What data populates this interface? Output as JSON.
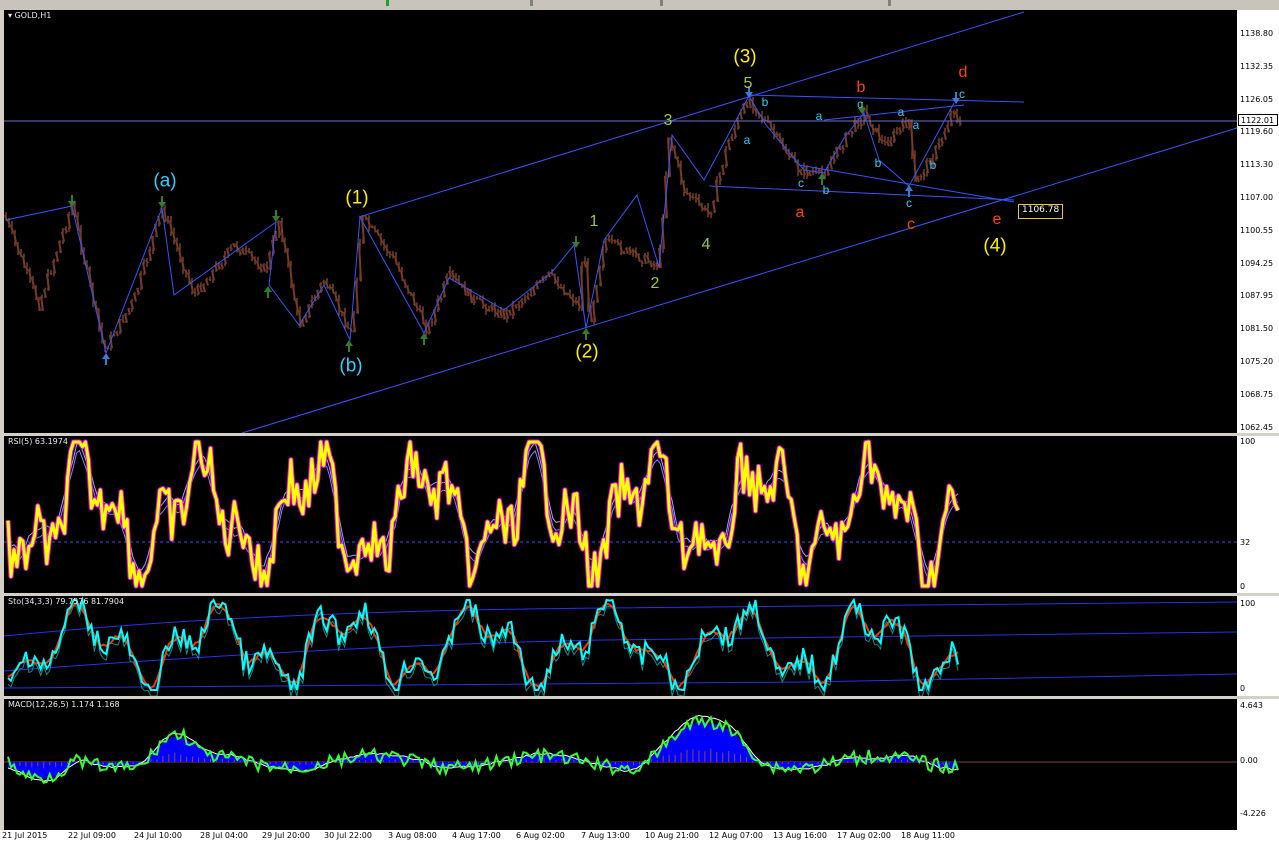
{
  "window": {
    "title": "GOLD,H1"
  },
  "main_chart": {
    "symbol_label": "GOLD,H1",
    "price_axis": [
      "1138.80",
      "1132.35",
      "1126.05",
      "1119.60",
      "1113.30",
      "1107.00",
      "1100.55",
      "1094.25",
      "1087.95",
      "1081.50",
      "1075.20",
      "1068.75",
      "1062.45"
    ],
    "current_price": "1122.01",
    "level_tag": "1106.78",
    "wave_labels": [
      {
        "text": "(a)",
        "color": "#33ccff",
        "size": "big"
      },
      {
        "text": "(b)",
        "color": "#33ccff",
        "size": "big"
      },
      {
        "text": "(1)",
        "color": "#ffee00",
        "size": "big"
      },
      {
        "text": "(2)",
        "color": "#ffee00",
        "size": "big"
      },
      {
        "text": "(3)",
        "color": "#ffee00",
        "size": "big"
      },
      {
        "text": "(4)",
        "color": "#ffee00",
        "size": "big"
      },
      {
        "text": "1",
        "color": "#99cc33",
        "size": "mid"
      },
      {
        "text": "2",
        "color": "#99cc33",
        "size": "mid"
      },
      {
        "text": "3",
        "color": "#99cc33",
        "size": "mid"
      },
      {
        "text": "4",
        "color": "#99cc33",
        "size": "mid"
      },
      {
        "text": "5",
        "color": "#99cc33",
        "size": "mid"
      },
      {
        "text": "a",
        "color": "#ff4400",
        "size": "mid"
      },
      {
        "text": "b",
        "color": "#ff4400",
        "size": "mid"
      },
      {
        "text": "c",
        "color": "#ff4400",
        "size": "mid"
      },
      {
        "text": "d",
        "color": "#ff4400",
        "size": "mid"
      },
      {
        "text": "e",
        "color": "#ff4400",
        "size": "mid"
      },
      {
        "text": "a",
        "color": "#33ccff",
        "size": "small"
      },
      {
        "text": "b",
        "color": "#33ccff",
        "size": "small"
      },
      {
        "text": "c",
        "color": "#33ccff",
        "size": "small"
      },
      {
        "text": "b",
        "color": "#33ccff",
        "size": "small"
      },
      {
        "text": "a",
        "color": "#33ccff",
        "size": "small"
      },
      {
        "text": "c",
        "color": "#33ccff",
        "size": "small"
      },
      {
        "text": "b",
        "color": "#33ccff",
        "size": "small"
      },
      {
        "text": "a",
        "color": "#33ccff",
        "size": "small"
      },
      {
        "text": "a",
        "color": "#33ccff",
        "size": "small"
      },
      {
        "text": "b",
        "color": "#33ccff",
        "size": "small"
      },
      {
        "text": "c",
        "color": "#33ccff",
        "size": "small"
      },
      {
        "text": "c",
        "color": "#33ccff",
        "size": "small"
      }
    ]
  },
  "rsi": {
    "title": "RSI(5) 63.1974",
    "axis": [
      "100",
      "32",
      "0"
    ]
  },
  "stoch": {
    "title": "Sto(34,3,3) 79.7576 81.7904",
    "axis": [
      "100",
      "0"
    ]
  },
  "macd": {
    "title": "MACD(12,26,5) 1.174 1.168",
    "axis": [
      "4.643",
      "0.00",
      "-4.226"
    ]
  },
  "time_axis": [
    "21 Jul 2015",
    "22 Jul 09:00",
    "24 Jul 10:00",
    "28 Jul 04:00",
    "29 Jul 20:00",
    "30 Jul 22:00",
    "3 Aug 08:00",
    "4 Aug 17:00",
    "6 Aug 02:00",
    "7 Aug 13:00",
    "10 Aug 21:00",
    "12 Aug 07:00",
    "13 Aug 16:00",
    "17 Aug 02:00",
    "18 Aug 11:00"
  ],
  "colors": {
    "background": "#000000",
    "bull_candle": "#b5654a",
    "channel": "#3355ff",
    "rsi_line": "#ffff00",
    "rsi_dots": "#ff00ff",
    "stoch_main": "#00ffff",
    "stoch_signal": "#ff3300",
    "macd_hist": "#0000ff",
    "macd_line": "#33ff33"
  }
}
